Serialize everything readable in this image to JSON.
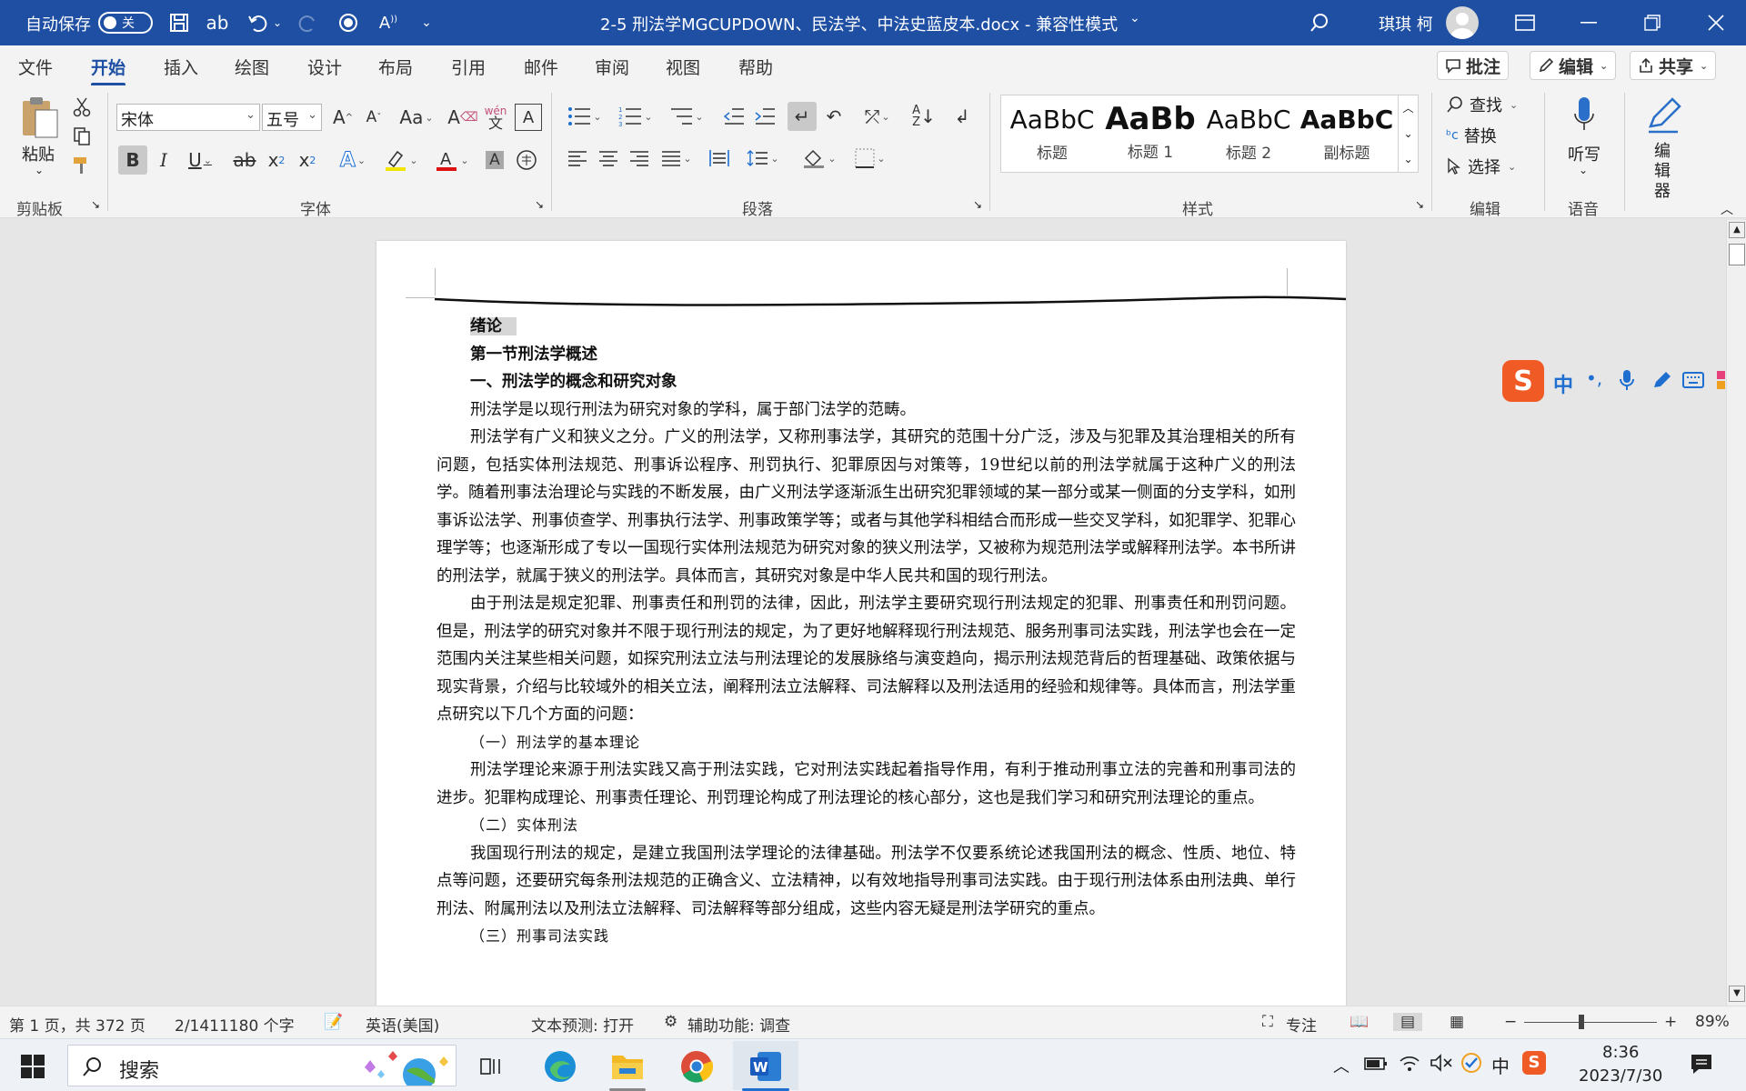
{
  "titlebar": {
    "autosave_label": "自动保存",
    "autosave_state": "关",
    "doc_title": "2-5 刑法学MGCUPDOWN、民法学、中法史蓝皮本.docx  -  兼容性模式",
    "user_name": "琪琪 柯",
    "color": "#1e4fa3"
  },
  "tabs": [
    "文件",
    "开始",
    "插入",
    "绘图",
    "设计",
    "布局",
    "引用",
    "邮件",
    "审阅",
    "视图",
    "帮助"
  ],
  "active_tab": "开始",
  "tab_right": {
    "comment": "批注",
    "edit": "编辑",
    "share": "共享"
  },
  "ribbon": {
    "clipboard": {
      "paste": "粘贴",
      "label": "剪贴板"
    },
    "font": {
      "name": "宋体",
      "size": "五号",
      "label": "字体",
      "phonetic": "wén",
      "phonetic_char": "文"
    },
    "paragraph": {
      "label": "段落"
    },
    "styles": {
      "label": "样式",
      "items": [
        {
          "preview": "AaBbC",
          "name": "标题"
        },
        {
          "preview": "AaBb",
          "name": "标题 1"
        },
        {
          "preview": "AaBbC",
          "name": "标题 2"
        },
        {
          "preview": "AaBbC",
          "name": "副标题"
        }
      ]
    },
    "editing": {
      "find": "查找",
      "replace": "替换",
      "select": "选择",
      "label": "编辑"
    },
    "voice": {
      "dictate": "听写",
      "label": "语音"
    },
    "editor": {
      "label": "编辑器"
    }
  },
  "document": {
    "heading": "绪论",
    "section": "第一节刑法学概述",
    "subsection": "一、刑法学的概念和研究对象",
    "paragraphs": [
      "刑法学是以现行刑法为研究对象的学科，属于部门法学的范畴。",
      "刑法学有广义和狭义之分。广义的刑法学，又称刑事法学，其研究的范围十分广泛，涉及与犯罪及其治理相关的所有问题，包括实体刑法规范、刑事诉讼程序、刑罚执行、犯罪原因与对策等，19世纪以前的刑法学就属于这种广义的刑法学。随着刑事法治理论与实践的不断发展，由广义刑法学逐渐派生出研究犯罪领域的某一部分或某一侧面的分支学科，如刑事诉讼法学、刑事侦查学、刑事执行法学、刑事政策学等；或者与其他学科相结合而形成一些交叉学科，如犯罪学、犯罪心理学等；也逐渐形成了专以一国现行实体刑法规范为研究对象的狭义刑法学，又被称为规范刑法学或解释刑法学。本书所讲的刑法学，就属于狭义的刑法学。具体而言，其研究对象是中华人民共和国的现行刑法。",
      "由于刑法是规定犯罪、刑事责任和刑罚的法律，因此，刑法学主要研究现行刑法规定的犯罪、刑事责任和刑罚问题。但是，刑法学的研究对象并不限于现行刑法的规定，为了更好地解释现行刑法规范、服务刑事司法实践，刑法学也会在一定范围内关注某些相关问题，如探究刑法立法与刑法理论的发展脉络与演变趋向，揭示刑法规范背后的哲理基础、政策依据与现实背景，介绍与比较域外的相关立法，阐释刑法立法解释、司法解释以及刑法适用的经验和规律等。具体而言，刑法学重点研究以下几个方面的问题："
    ],
    "item1": "（一）刑法学的基本理论",
    "para4": "刑法学理论来源于刑法实践又高于刑法实践，它对刑法实践起着指导作用，有利于推动刑事立法的完善和刑事司法的进步。犯罪构成理论、刑事责任理论、刑罚理论构成了刑法理论的核心部分，这也是我们学习和研究刑法理论的重点。",
    "item2": "（二）实体刑法",
    "para5": "我国现行刑法的规定，是建立我国刑法学理论的法律基础。刑法学不仅要系统论述我国刑法的概念、性质、地位、特点等问题，还要研究每条刑法规范的正确含义、立法精神，以有效地指导刑事司法实践。由于现行刑法体系由刑法典、单行刑法、附属刑法以及刑法立法解释、司法解释等部分组成，这些内容无疑是刑法学研究的重点。",
    "item3": "（三）刑事司法实践"
  },
  "ime": {
    "lang": "中",
    "punct": "•,"
  },
  "statusbar": {
    "page": "第 1 页，共 372 页",
    "words": "2/1411180 个字",
    "language": "英语(美国)",
    "prediction": "文本预测: 打开",
    "accessibility": "辅助功能: 调查",
    "focus": "专注",
    "zoom": "89%"
  },
  "taskbar": {
    "search": "搜索",
    "time": "8:36",
    "date": "2023/7/30",
    "ime_lang": "中"
  }
}
